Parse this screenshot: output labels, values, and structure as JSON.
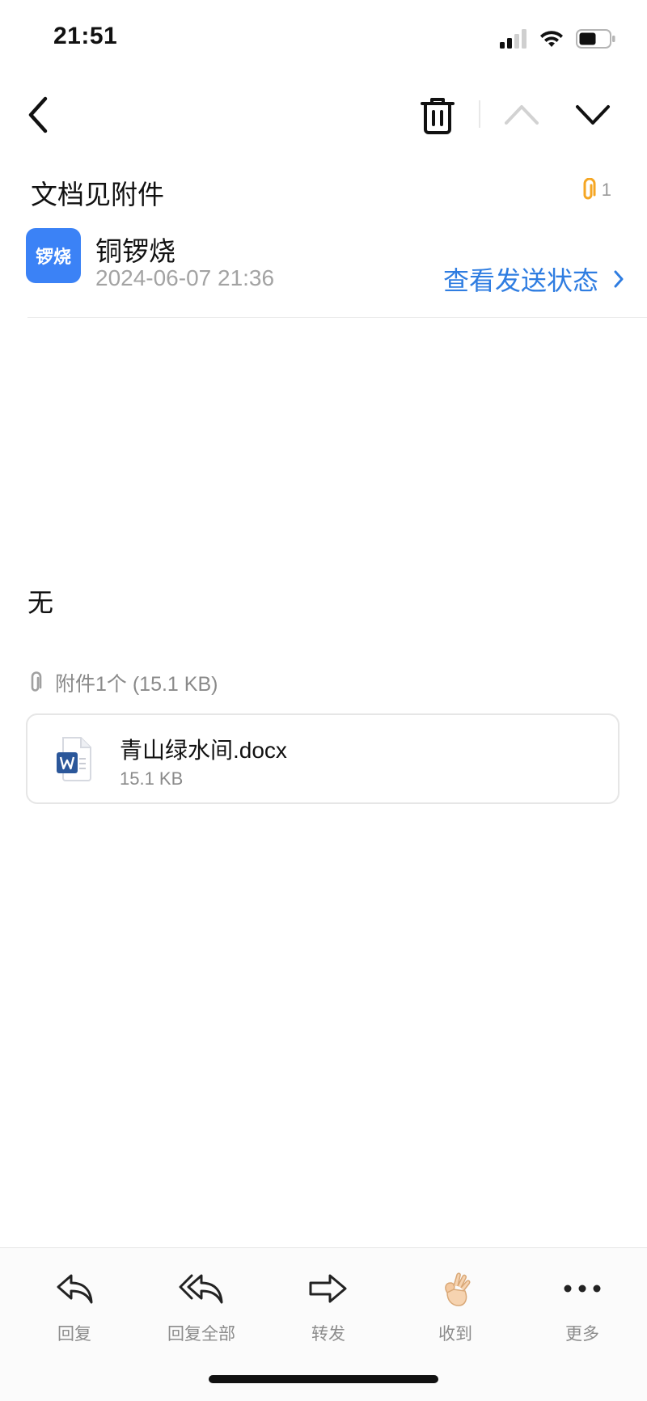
{
  "status_bar": {
    "time": "21:51",
    "battery_level": 0.55
  },
  "email": {
    "subject": "文档见附件",
    "attachment_count": "1",
    "sender": {
      "avatar_text": "锣烧",
      "name": "铜锣烧",
      "avatar_color": "#3b82f6"
    },
    "sent_time": "2024-06-07 21:36",
    "send_status_link": "查看发送状态",
    "body": "无"
  },
  "attachments": {
    "heading": "附件1个 (15.1 KB)",
    "items": [
      {
        "name": "青山绿水间.docx",
        "size": "15.1 KB",
        "icon": "word-doc-icon"
      }
    ]
  },
  "toolbar": {
    "reply": "回复",
    "reply_all": "回复全部",
    "forward": "转发",
    "received": "收到",
    "more": "更多"
  },
  "colors": {
    "accent": "#2f7de1",
    "attachment_clip": "#f5a623",
    "word_blue": "#2b579a"
  }
}
